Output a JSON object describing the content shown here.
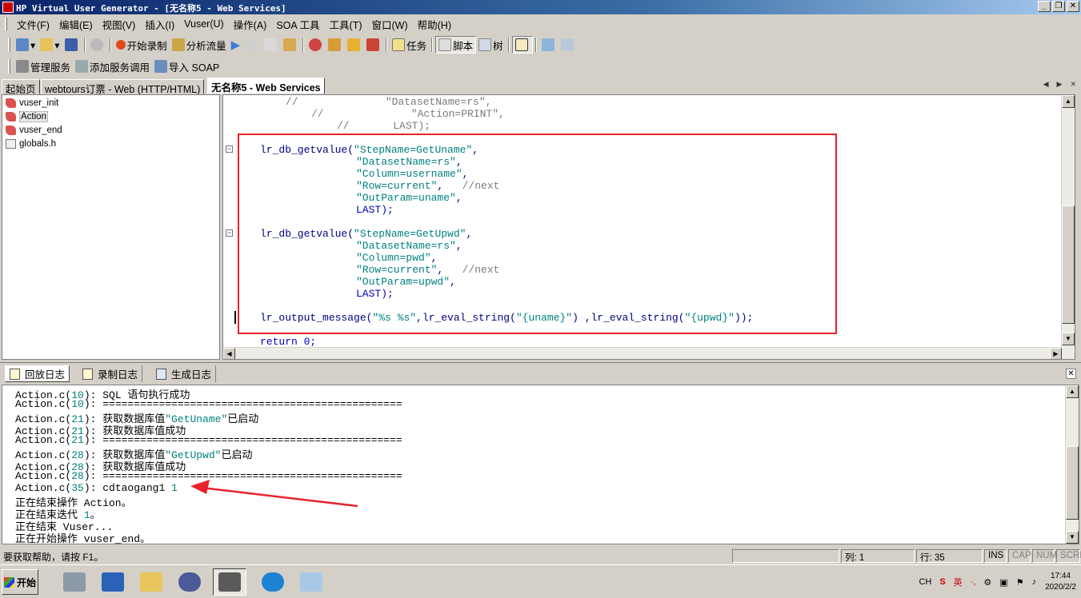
{
  "window": {
    "title": "HP Virtual User Generator - [无名称5 - Web Services]"
  },
  "menubar": {
    "items": [
      "文件(F)",
      "编辑(E)",
      "视图(V)",
      "插入(I)",
      "Vuser(U)",
      "操作(A)",
      "SOA 工具",
      "工具(T)",
      "窗口(W)",
      "帮助(H)"
    ]
  },
  "toolbar1": {
    "start_record": "开始录制",
    "analyze_flow": "分析流量",
    "tasks": "任务",
    "script_view": "脚本",
    "tree_view": "树"
  },
  "toolbar2": {
    "manage_services": "管理服务",
    "add_service_call": "添加服务调用",
    "import_soap": "导入 SOAP"
  },
  "tabs": [
    "起始页",
    "webtours订票 - Web (HTTP/HTML)",
    "无名称5 - Web Services"
  ],
  "tree": {
    "items": [
      "vuser_init",
      "Action",
      "vuser_end",
      "globals.h"
    ]
  },
  "code": {
    "comment1": "//              \"DatasetName=rs\",",
    "comment2": "//              \"Action=PRINT\",",
    "comment3": "//       LAST);",
    "b1_fn": "lr_db_getvalue(",
    "b1_a1": "\"StepName=GetUname\"",
    "b1_a2": "\"DatasetName=rs\"",
    "b1_a3": "\"Column=username\"",
    "b1_a4": "\"Row=current\"",
    "b1_a4c": "//next",
    "b1_a5": "\"OutParam=uname\"",
    "last": "LAST);",
    "b2_fn": "lr_db_getvalue(",
    "b2_a1": "\"StepName=GetUpwd\"",
    "b2_a2": "\"DatasetName=rs\"",
    "b2_a3": "\"Column=pwd\"",
    "b2_a4": "\"Row=current\"",
    "b2_a4c": "//next",
    "b2_a5": "\"OutParam=upwd\"",
    "out_fn": "lr_output_message(",
    "out_fmt": "\"%s %s\"",
    "out_mid1": ",lr_eval_string(",
    "out_s1": "\"{uname}\"",
    "out_mid2": ") ,lr_eval_string(",
    "out_s2": "\"{upwd}\"",
    "out_end": "));",
    "ret": "return 0;"
  },
  "logtabs": [
    "回放日志",
    "录制日志",
    "生成日志"
  ],
  "log": [
    {
      "pre": "Action.c(",
      "num": "10",
      "post": "): SQL 语句执行成功"
    },
    {
      "pre": "Action.c(",
      "num": "10",
      "post": "): ================================================"
    },
    {
      "pre": "Action.c(",
      "num": "21",
      "post": "): 获取数据库值",
      "str": "\"GetUname\"",
      "tail": "已启动"
    },
    {
      "pre": "Action.c(",
      "num": "21",
      "post": "): 获取数据库值成功"
    },
    {
      "pre": "Action.c(",
      "num": "21",
      "post": "): ================================================"
    },
    {
      "pre": "Action.c(",
      "num": "28",
      "post": "): 获取数据库值",
      "str": "\"GetUpwd\"",
      "tail": "已启动"
    },
    {
      "pre": "Action.c(",
      "num": "28",
      "post": "): 获取数据库值成功"
    },
    {
      "pre": "Action.c(",
      "num": "28",
      "post": "): ================================================"
    },
    {
      "pre": "Action.c(",
      "num": "35",
      "post": "): cdtaogang1 ",
      "num2": "1"
    },
    {
      "pre": "正在结束操作 Action。"
    },
    {
      "pre": "正在结束迭代 ",
      "num": "1",
      "post": "。"
    },
    {
      "pre": "正在结束 Vuser..."
    },
    {
      "pre": "正在开始操作 vuser_end。"
    }
  ],
  "status": {
    "message": "要获取帮助，请按 F1。",
    "col": "列: 1",
    "row": "行: 35",
    "ins": "INS",
    "cap": "CAP",
    "num": "NUM",
    "scrl": "SCRL"
  },
  "taskbar": {
    "start": "开始",
    "lang": "CH",
    "ime_en": "英",
    "ime_dot": "·,",
    "time": "17:44",
    "date": "2020/2/2"
  },
  "colors": {
    "annotation_red": "#e8222a",
    "code_blue": "#000080",
    "string_teal": "#008080"
  }
}
